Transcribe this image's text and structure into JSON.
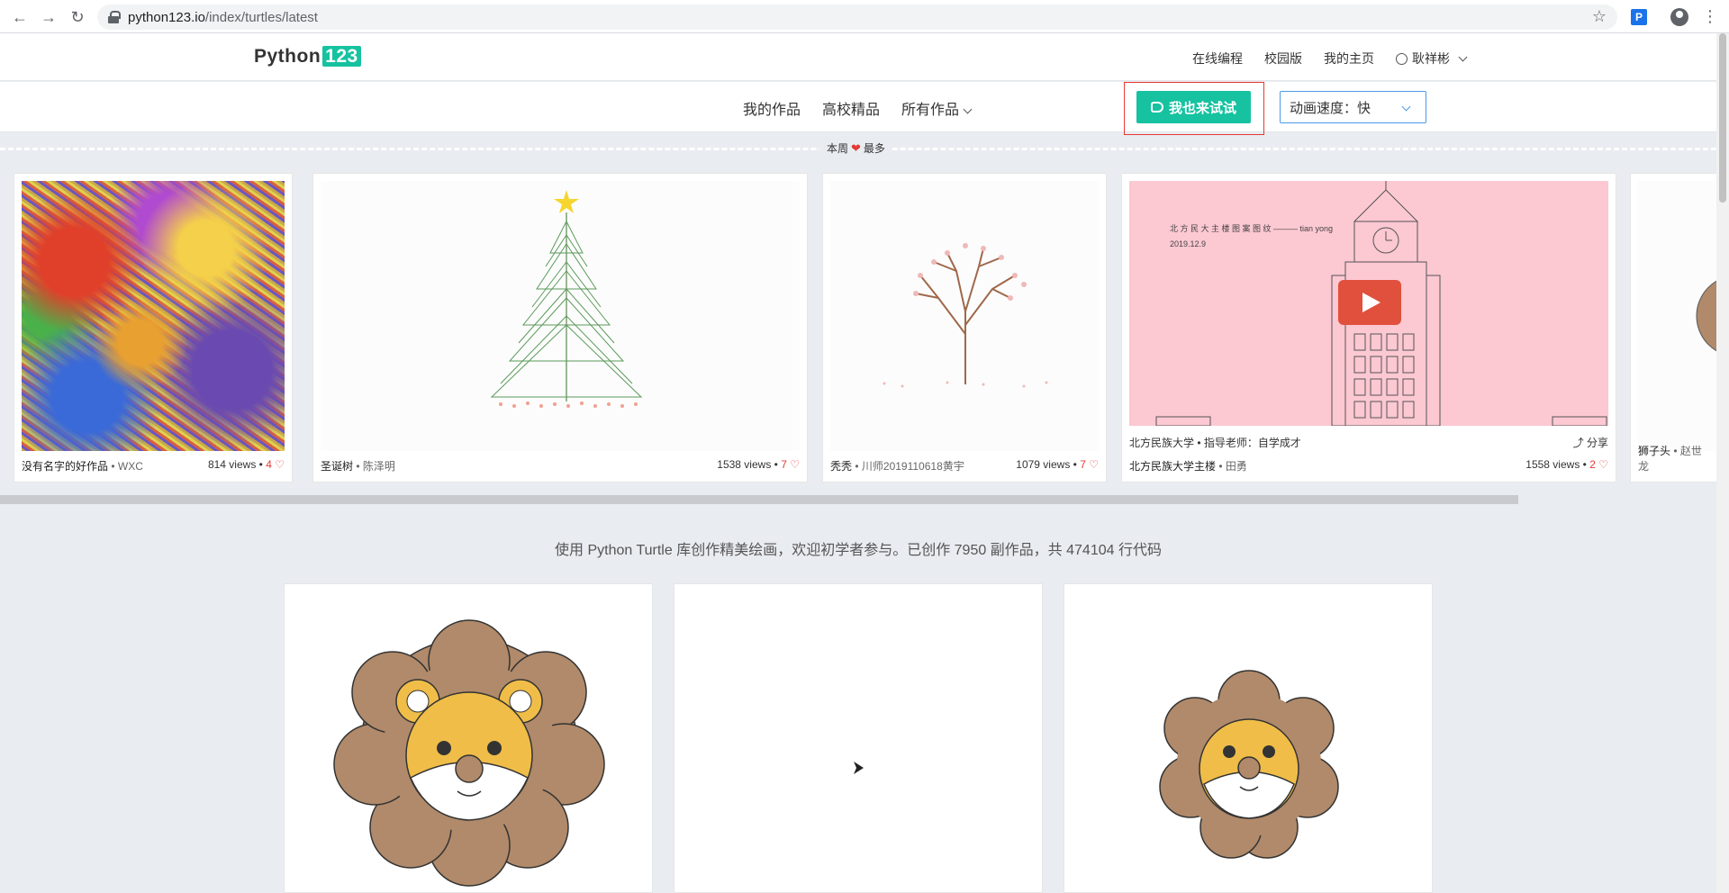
{
  "browser": {
    "url_host": "python123.io",
    "url_path": "/index/turtles/latest",
    "ext_label": "P"
  },
  "header": {
    "logo_text": "Python",
    "logo_num": "123",
    "links": [
      "在线编程",
      "校园版",
      "我的主页"
    ],
    "user_name": "耿祥彬"
  },
  "subnav": {
    "tabs": [
      "我的作品",
      "高校精品",
      "所有作品"
    ],
    "try_label": "我也来试试",
    "speed_label": "动画速度：快"
  },
  "week_label": {
    "prefix": "本周",
    "suffix": "最多"
  },
  "carousel": [
    {
      "title": "没有名字的好作品",
      "author": "WXC",
      "views": "814 views",
      "likes": "4"
    },
    {
      "title": "圣诞树",
      "author": "陈泽明",
      "views": "1538 views",
      "likes": "7"
    },
    {
      "title": "秃秃",
      "author": "川师2019110618黄宇",
      "views": "1079 views",
      "likes": "7"
    },
    {
      "title": "北方民族大学主楼",
      "author": "田勇",
      "views": "1558 views",
      "likes": "2",
      "school": "北方民族大学 • 指导老师：自学成才",
      "share": "分享",
      "art_text1": "北 方 民 大 主 楼 图 案 图 纹 ——— tian yong",
      "art_text2": "2019.12.9"
    },
    {
      "title": "狮子头",
      "author": "赵世龙"
    }
  ],
  "intro": "使用 Python Turtle 库创作精美绘画，欢迎初学者参与。已创作 7950 副作品，共 474104 行代码",
  "colors": {
    "accent": "#16c2a0",
    "heart": "#e53935",
    "select_border": "#4a9be8"
  }
}
